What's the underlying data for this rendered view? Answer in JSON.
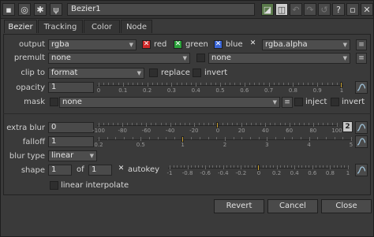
{
  "header": {
    "node_name": "Bezier1"
  },
  "tabs": [
    "Bezier",
    "Tracking",
    "Color",
    "Node"
  ],
  "labels": {
    "output": "output",
    "premult": "premult",
    "clip_to": "clip to",
    "opacity": "opacity",
    "mask": "mask",
    "extra_blur": "extra blur",
    "falloff": "falloff",
    "blur_type": "blur type",
    "shape": "shape"
  },
  "output": {
    "value": "rgba",
    "red": "red",
    "green": "green",
    "blue": "blue",
    "alpha_value": "rgba.alpha"
  },
  "premult": {
    "value": "none",
    "second": "none"
  },
  "clip_to": {
    "value": "format",
    "replace": "replace",
    "invert": "invert"
  },
  "opacity": {
    "value": "1",
    "ticks": [
      "0",
      "0.1",
      "0.2",
      "0.3",
      "0.4",
      "0.5",
      "0.6",
      "0.7",
      "0.8",
      "0.9",
      "1"
    ],
    "level": 1
  },
  "mask": {
    "value": "none",
    "inject": "inject",
    "invert": "invert"
  },
  "extra_blur": {
    "value": "0",
    "ticks": [
      "-100",
      "-80",
      "-60",
      "-40",
      "-20",
      "0",
      "20",
      "40",
      "60",
      "80",
      "100"
    ],
    "level": 0,
    "channels_badge": "2"
  },
  "falloff": {
    "value": "1",
    "ticks": [
      "0.2",
      "0.5",
      "1",
      "2",
      "3",
      "4",
      "5"
    ],
    "level": 1
  },
  "blur_type": {
    "value": "linear"
  },
  "shape": {
    "value": "1",
    "of_label": "of",
    "total": "1",
    "autokey": "autokey",
    "ticks": [
      "-1",
      "-0.8",
      "-0.6",
      "-0.4",
      "-0.2",
      "0",
      "0.2",
      "0.4",
      "0.6",
      "0.8",
      "1"
    ],
    "level": 0
  },
  "linear_interpolate": "linear interpolate",
  "footer": {
    "revert": "Revert",
    "cancel": "Cancel",
    "close": "Close"
  }
}
